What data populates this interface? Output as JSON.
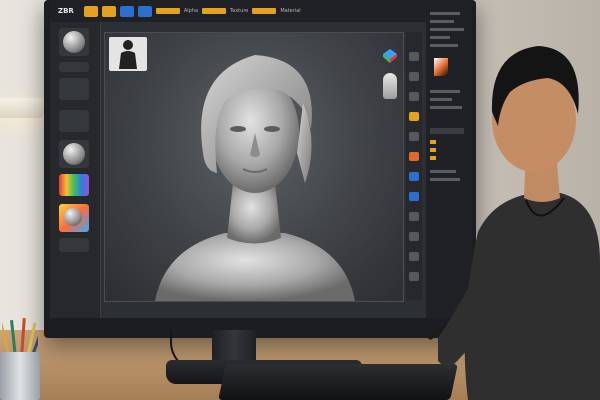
{
  "app": {
    "logo": "ZBR",
    "topbar_labels": [
      "Alpha",
      "Texture",
      "Material"
    ]
  },
  "colors": {
    "accent": "#e7a21d",
    "blue_button": "#2a6fd1",
    "viewport_bg": "#3f4246",
    "sculpt_clay": "#b9b9b9"
  },
  "icons": {
    "brush": "sphere-brush-icon",
    "material": "matcap-sphere-icon",
    "gizmo": "axis-gizmo-icon"
  }
}
